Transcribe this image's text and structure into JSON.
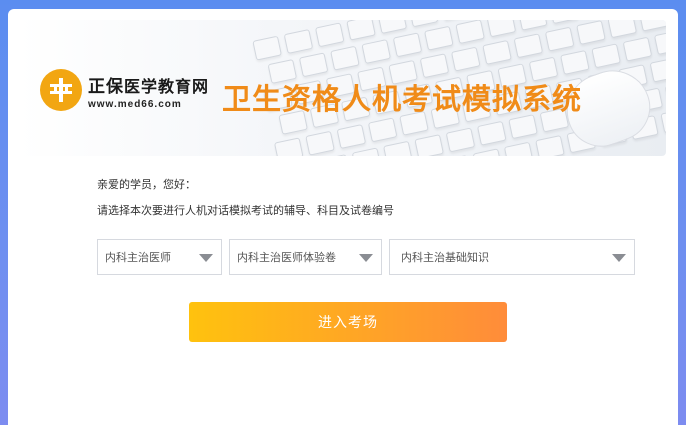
{
  "banner": {
    "brand_name_prefix": "正保",
    "brand_name_suffix": "医学教育网",
    "brand_url": "www.med66.com",
    "system_title": "卫生资格人机考试模拟系统",
    "logo_icon": "med66-logo-icon",
    "title_color": "#f08b18"
  },
  "form": {
    "greeting": "亲爱的学员，您好：",
    "instruction": "请选择本次要进行人机对话模拟考试的辅导、科目及试卷编号",
    "selects": [
      {
        "value": "内科主治医师"
      },
      {
        "value": "内科主治医师体验卷"
      },
      {
        "value": "内科主治基础知识"
      }
    ],
    "enter_button": "进入考场",
    "button_gradient": [
      "#ffc20e",
      "#ff8c3a"
    ]
  }
}
